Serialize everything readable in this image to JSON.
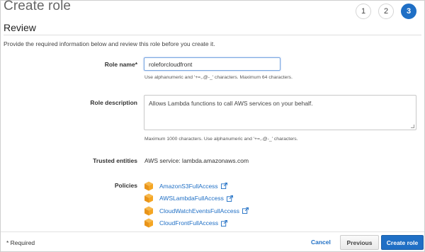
{
  "header": {
    "title": "Create role",
    "steps": [
      "1",
      "2",
      "3"
    ],
    "active_step": "3"
  },
  "review": {
    "title": "Review",
    "intro": "Provide the required information below and review this role before you create it."
  },
  "role_name": {
    "label": "Role name*",
    "value": "roleforcloudfront",
    "hint": "Use alphanumeric and '+=,.@-_' characters. Maximum 64 characters."
  },
  "role_description": {
    "label": "Role description",
    "value": "Allows Lambda functions to call AWS services on your behalf.",
    "hint": "Maximum 1000 characters. Use alphanumeric and '+=,.@-_' characters."
  },
  "trusted_entities": {
    "label": "Trusted entities",
    "value": "AWS service: lambda.amazonaws.com"
  },
  "policies": {
    "label": "Policies",
    "items": [
      {
        "name": "AmazonS3FullAccess",
        "icon": "aws-box-icon"
      },
      {
        "name": "AWSLambdaFullAccess",
        "icon": "aws-box-icon"
      },
      {
        "name": "CloudWatchEventsFullAccess",
        "icon": "aws-box-icon"
      },
      {
        "name": "CloudFrontFullAccess",
        "icon": "aws-box-icon"
      }
    ]
  },
  "footer": {
    "required_note": "* Required",
    "cancel_label": "Cancel",
    "previous_label": "Previous",
    "create_label": "Create role"
  },
  "colors": {
    "accent": "#1f6fc5",
    "policy_icon": "#f5a623"
  }
}
